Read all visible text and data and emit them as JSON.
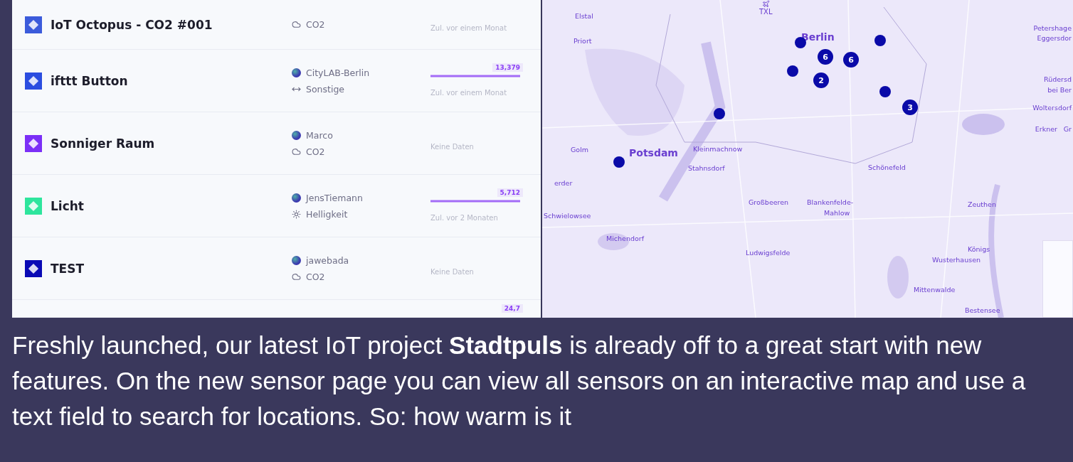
{
  "sensors": [
    {
      "name": "IoT Octopus - CO2 #001",
      "color": "#3b5bdb",
      "category": "CO2",
      "kind": "co2",
      "updated": "Zul. vor einem Monat"
    },
    {
      "name": "ifttt Button",
      "color": "#2b4de0",
      "owner": "CityLAB-Berlin",
      "category": "Sonstige",
      "kind": "other",
      "value": "13,379",
      "updated": "Zul. vor einem Monat"
    },
    {
      "name": "Sonniger Raum",
      "color": "#7b2ff7",
      "owner": "Marco",
      "category": "CO2",
      "kind": "co2",
      "updated": "Keine Daten"
    },
    {
      "name": "Licht",
      "color": "#2ee59d",
      "owner": "JensTiemann",
      "category": "Helligkeit",
      "kind": "brightness",
      "value": "5,712",
      "updated": "Zul. vor 2 Monaten"
    },
    {
      "name": "TEST",
      "color": "#0a0ab5",
      "owner": "jawebada",
      "category": "CO2",
      "kind": "co2",
      "updated": "Keine Daten"
    },
    {
      "value": "24,7"
    }
  ],
  "map": {
    "airport": "TXL",
    "places": [
      "Elstal",
      "Priort",
      "Berlin",
      "Petershage",
      "Eggersdor",
      "Rüdersd",
      "bei Ber",
      "Woltersdorf",
      "Erkner",
      "Gr",
      "Golm",
      "Potsdam",
      "Kleinmachnow",
      "Stahnsdorf",
      "Schönefeld",
      "erder",
      "Großbeeren",
      "Blankenfelde-",
      "Mahlow",
      "Zeuthen",
      "Schwielowsee",
      "Michendorf",
      "Ludwigsfelde",
      "Königs",
      "Wusterhausen",
      "Mittenwalde",
      "Bestensee"
    ],
    "markers": [
      {
        "kind": "point"
      },
      {
        "kind": "point"
      },
      {
        "kind": "cluster",
        "count": "6"
      },
      {
        "kind": "cluster",
        "count": "6"
      },
      {
        "kind": "point"
      },
      {
        "kind": "cluster",
        "count": "2"
      },
      {
        "kind": "point"
      },
      {
        "kind": "cluster",
        "count": "3"
      },
      {
        "kind": "point"
      },
      {
        "kind": "point"
      }
    ]
  },
  "article": {
    "text": "Freshly launched, our latest IoT project **Stadtpuls** is already off to a great start with new features. On the new sensor page you can view all sensors on an interactive map and use a text field to search for locations. So: how warm is it"
  }
}
